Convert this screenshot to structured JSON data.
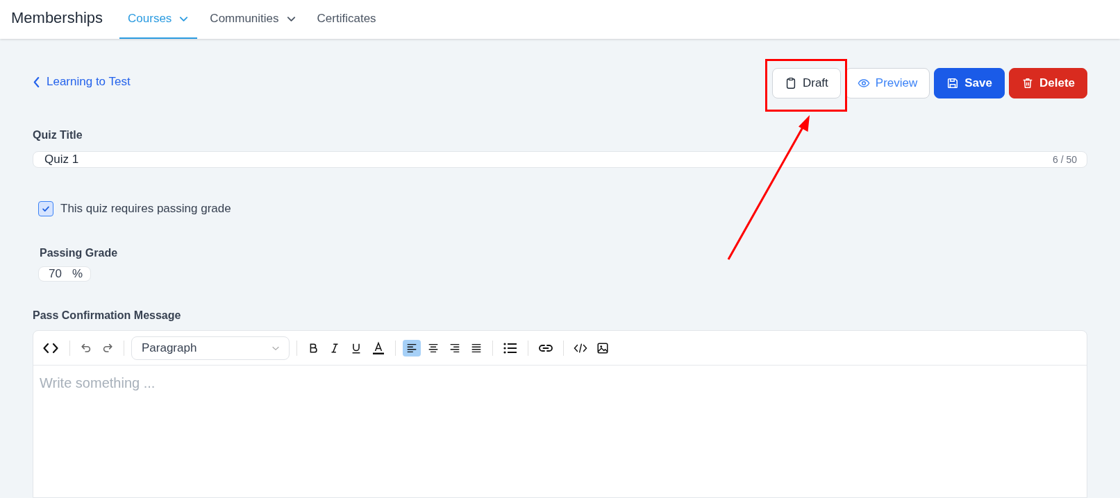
{
  "header": {
    "title": "Memberships",
    "tabs": [
      {
        "label": "Courses",
        "selected": true,
        "dropdown": true
      },
      {
        "label": "Communities",
        "selected": false,
        "dropdown": true
      },
      {
        "label": "Certificates",
        "selected": false,
        "dropdown": false
      }
    ]
  },
  "back_link": "Learning to Test",
  "actions": [
    {
      "kind": "draft",
      "label": "Draft"
    },
    {
      "kind": "preview",
      "label": "Preview"
    },
    {
      "kind": "save",
      "label": "Save"
    },
    {
      "kind": "delete",
      "label": "Delete"
    }
  ],
  "quiz_title": {
    "label": "Quiz Title",
    "value": "Quiz 1",
    "counter": "6 / 50"
  },
  "passing_required": {
    "label": "This quiz requires passing grade",
    "checked": true
  },
  "passing_grade": {
    "label": "Passing Grade",
    "value": "70",
    "unit": "%"
  },
  "pass_message": {
    "label": "Pass Confirmation Message",
    "format": "Paragraph",
    "placeholder": "Write something ...",
    "alignments": [
      {
        "kind": "left",
        "selected": true
      },
      {
        "kind": "center",
        "selected": false
      },
      {
        "kind": "right",
        "selected": false
      },
      {
        "kind": "justify",
        "selected": false
      }
    ]
  },
  "annotation": {
    "kind": "box-and-arrow"
  }
}
